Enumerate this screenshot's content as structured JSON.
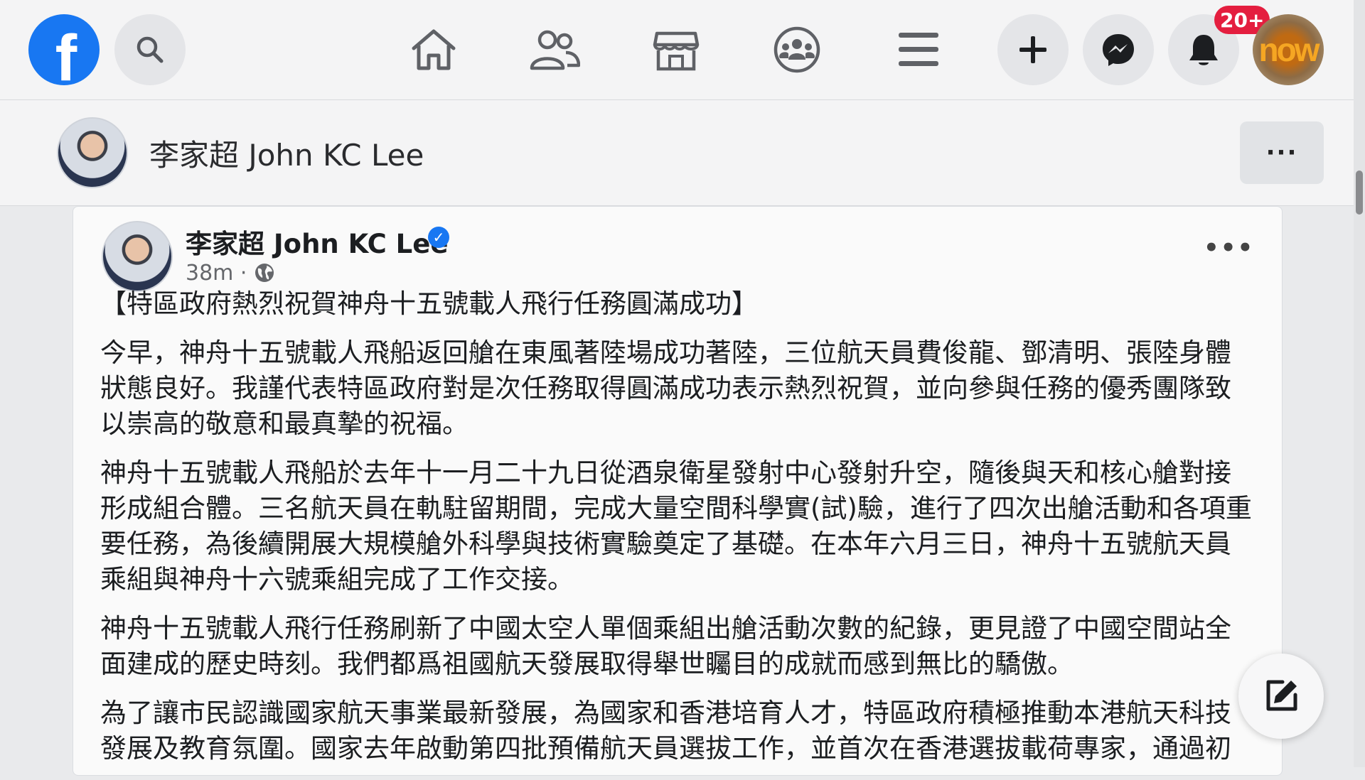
{
  "topbar": {
    "logo_letter": "f",
    "notification_count": "20+",
    "profile_avatar_text": "now",
    "icons": [
      "facebook-logo",
      "search-icon",
      "home-icon",
      "friends-icon",
      "marketplace-icon",
      "groups-icon",
      "menu-icon",
      "plus-icon",
      "messenger-icon",
      "bell-icon"
    ]
  },
  "page_header": {
    "name": "李家超 John KC Lee",
    "more_label": "···"
  },
  "post": {
    "author": "李家超 John KC Lee",
    "verified_mark": "✓",
    "time": "38m · ",
    "more_label": "•••",
    "title": "【特區政府熱烈祝賀神舟十五號載人飛行任務圓滿成功】",
    "paragraphs": [
      "今早，神舟十五號載人飛船返回艙在東風著陸場成功著陸，三位航天員費俊龍、鄧清明、張陸身體狀態良好。我謹代表特區政府對是次任務取得圓滿成功表示熱烈祝賀，並向參與任務的優秀團隊致以崇高的敬意和最真摯的祝福。",
      "神舟十五號載人飛船於去年十一月二十九日從酒泉衛星發射中心發射升空，隨後與天和核心艙對接形成組合體。三名航天員在軌駐留期間，完成大量空間科學實(試)驗，進行了四次出艙活動和各項重要任務，為後續開展大規模艙外科學與技術實驗奠定了基礎。在本年六月三日，神舟十五號航天員乘組與神舟十六號乘組完成了工作交接。",
      "神舟十五號載人飛行任務刷新了中國太空人單個乘組出艙活動次數的紀錄，更見證了中國空間站全面建成的歷史時刻。我們都爲祖國航天發展取得舉世矚目的成就而感到無比的驕傲。",
      "為了讓市民認識國家航天事業最新發展，為國家和香港培育人才，特區政府積極推動本港航天科技發展及教育氛圍。國家去年啟動第四批預備航天員選拔工作，並首次在香港選拔載荷專家，通過初"
    ]
  },
  "colors": {
    "brand_blue": "#1877f2",
    "badge_red": "#e41e3f",
    "text_primary": "#1c1e21",
    "text_secondary": "#65676b"
  }
}
